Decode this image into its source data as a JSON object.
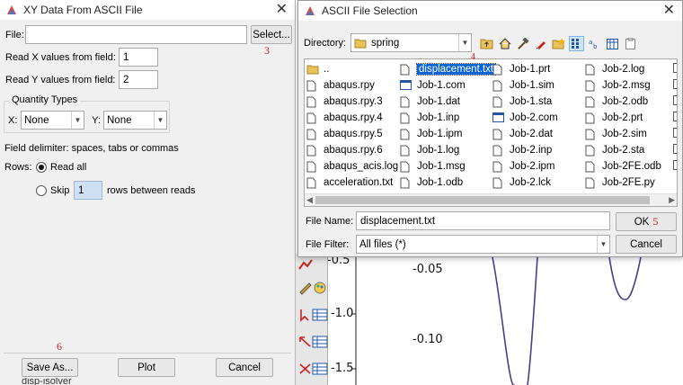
{
  "left_dialog": {
    "title": "XY Data From ASCII File",
    "close": "✕",
    "file_label": "File:",
    "file_value": "",
    "select_button": "Select...",
    "read_x_label": "Read X values from field:",
    "read_x_value": "1",
    "read_y_label": "Read Y values from field:",
    "read_y_value": "2",
    "quantity_group": "Quantity Types",
    "x_label": "X:",
    "x_value": "None",
    "y_label": "Y:",
    "y_value": "None",
    "delimiter_text": "Field delimiter: spaces, tabs or commas",
    "rows_label": "Rows:",
    "read_all_label": "Read all",
    "skip_label": "Skip",
    "skip_value": "1",
    "rows_between": "rows between reads",
    "save_as": "Save As...",
    "plot": "Plot",
    "cancel": "Cancel",
    "marker_3": "3",
    "marker_6": "6",
    "bottom_fragment": "disp-isolver"
  },
  "right_dialog": {
    "title": "ASCII File Selection",
    "close": "✕",
    "directory_label": "Directory:",
    "directory_value": "spring",
    "file_name_label": "File Name:",
    "file_name_value": "displacement.txt",
    "file_filter_label": "File Filter:",
    "file_filter_value": "All files (*)",
    "ok": "OK",
    "cancel": "Cancel",
    "marker_4": "4",
    "marker_5": "5",
    "columns": [
      [
        {
          "name": "..",
          "icon": "folder"
        },
        {
          "name": "abaqus.rpy",
          "icon": "doc"
        },
        {
          "name": "abaqus.rpy.3",
          "icon": "doc"
        },
        {
          "name": "abaqus.rpy.4",
          "icon": "doc"
        },
        {
          "name": "abaqus.rpy.5",
          "icon": "doc"
        },
        {
          "name": "abaqus.rpy.6",
          "icon": "doc"
        },
        {
          "name": "abaqus_acis.log",
          "icon": "doc"
        },
        {
          "name": "acceleration.txt",
          "icon": "doc"
        }
      ],
      [
        {
          "name": "displacement.txt",
          "icon": "doc",
          "selected": true
        },
        {
          "name": "Job-1.com",
          "icon": "window"
        },
        {
          "name": "Job-1.dat",
          "icon": "doc"
        },
        {
          "name": "Job-1.inp",
          "icon": "doc"
        },
        {
          "name": "Job-1.ipm",
          "icon": "doc"
        },
        {
          "name": "Job-1.log",
          "icon": "doc"
        },
        {
          "name": "Job-1.msg",
          "icon": "doc"
        },
        {
          "name": "Job-1.odb",
          "icon": "doc"
        }
      ],
      [
        {
          "name": "Job-1.prt",
          "icon": "doc"
        },
        {
          "name": "Job-1.sim",
          "icon": "doc"
        },
        {
          "name": "Job-1.sta",
          "icon": "doc"
        },
        {
          "name": "Job-2.com",
          "icon": "window"
        },
        {
          "name": "Job-2.dat",
          "icon": "doc"
        },
        {
          "name": "Job-2.inp",
          "icon": "doc"
        },
        {
          "name": "Job-2.ipm",
          "icon": "doc"
        },
        {
          "name": "Job-2.lck",
          "icon": "doc"
        }
      ],
      [
        {
          "name": "Job-2.log",
          "icon": "doc"
        },
        {
          "name": "Job-2.msg",
          "icon": "doc"
        },
        {
          "name": "Job-2.odb",
          "icon": "doc"
        },
        {
          "name": "Job-2.prt",
          "icon": "doc"
        },
        {
          "name": "Job-2.sim",
          "icon": "doc"
        },
        {
          "name": "Job-2.sta",
          "icon": "doc"
        },
        {
          "name": "Job-2FE.odb",
          "icon": "doc"
        },
        {
          "name": "Job-2FE.py",
          "icon": "doc"
        }
      ]
    ]
  },
  "background_plot": {
    "left_axis_labels": [
      "-0.5",
      "-1.0",
      "-1.5"
    ],
    "right_axis_labels": [
      "-0.05",
      "-0.10"
    ]
  },
  "colors": {
    "selection": "#0a64d6",
    "marker": "#d21c1c",
    "curve": "#5a3f8c"
  }
}
